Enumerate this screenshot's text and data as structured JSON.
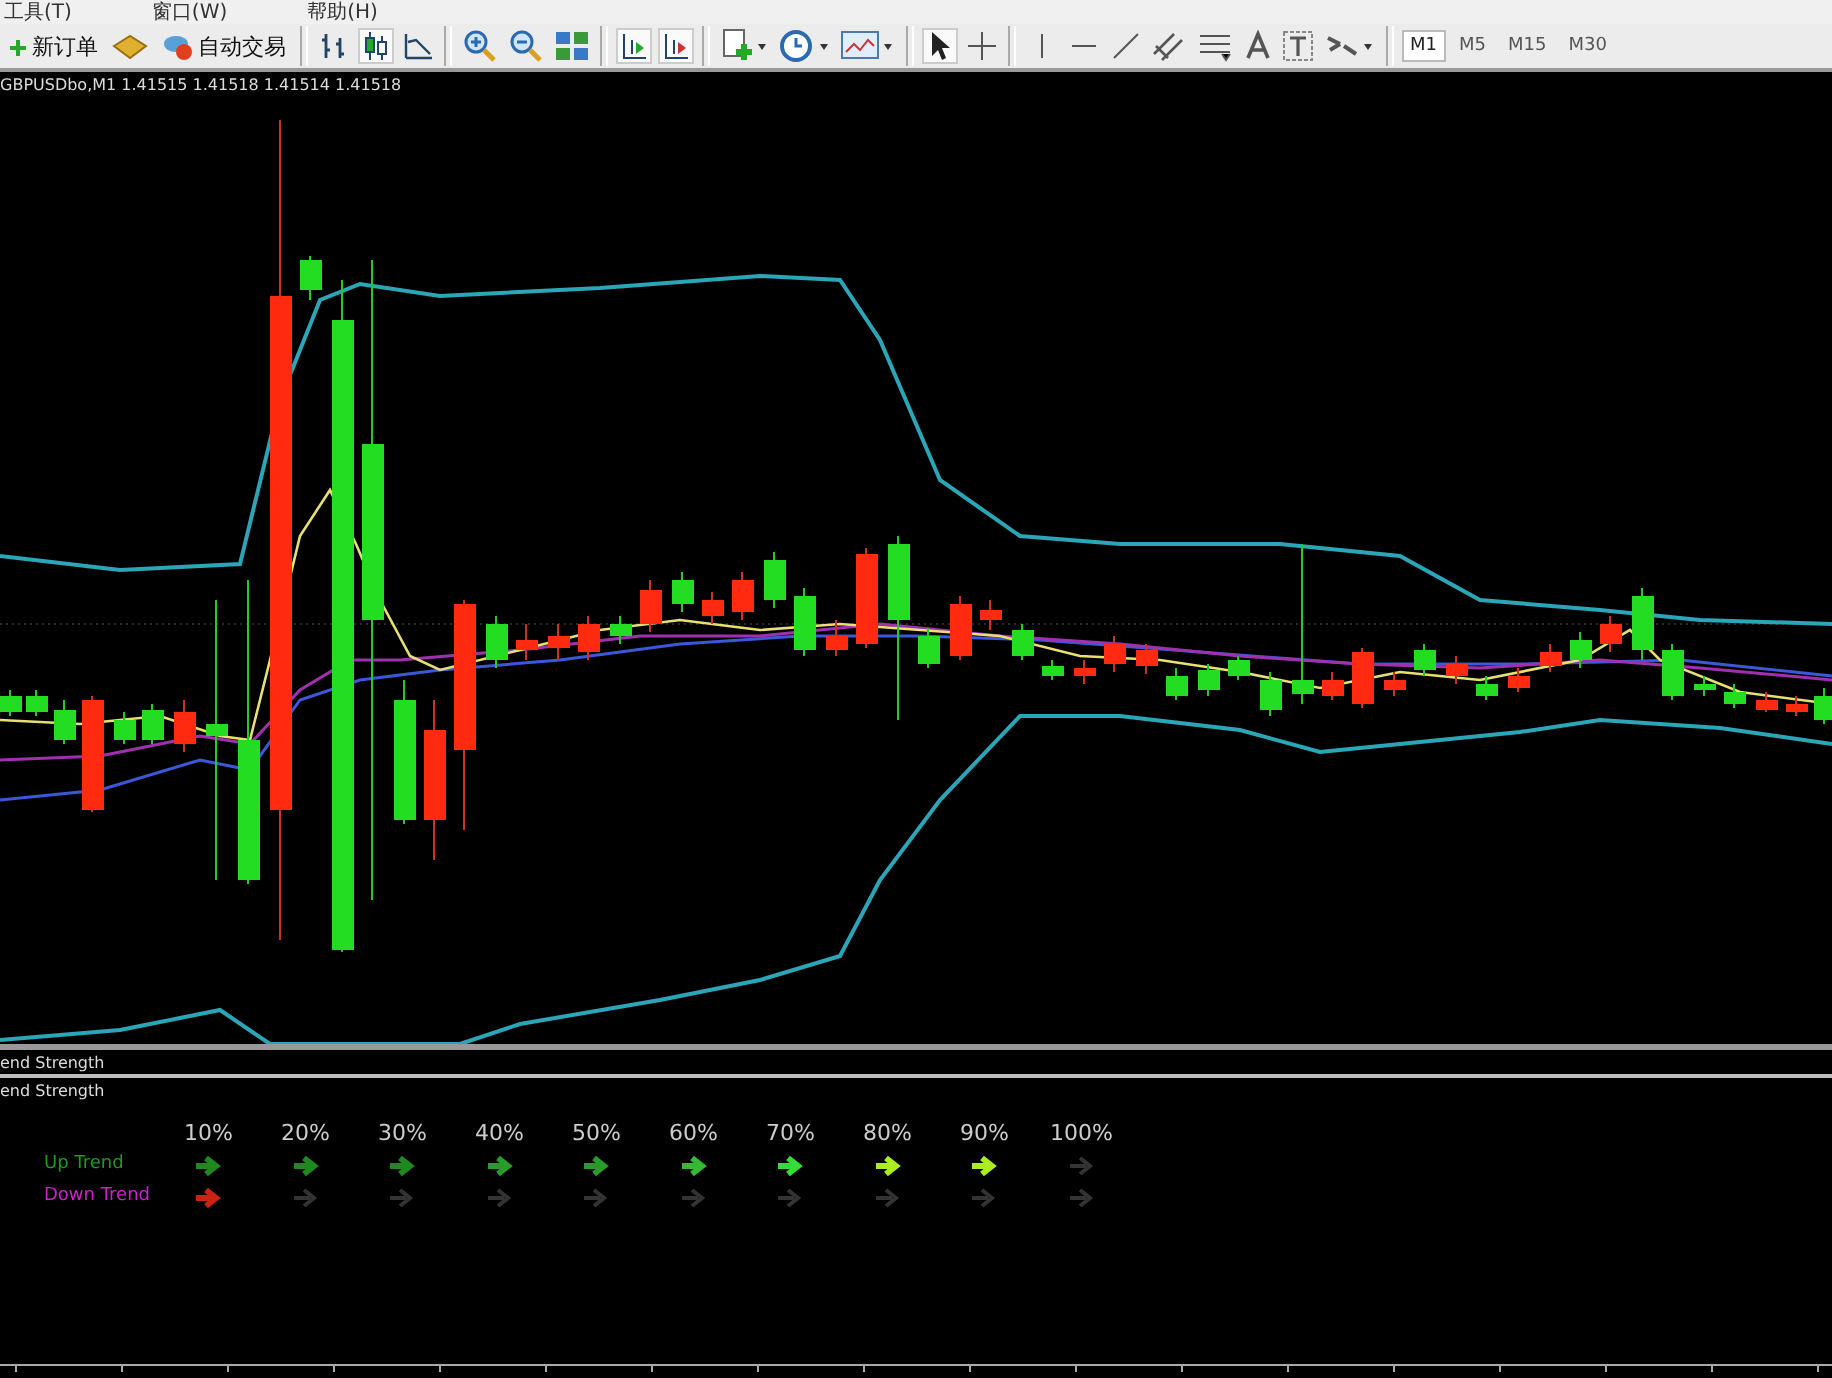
{
  "menu": [
    "工具(T)",
    "窗口(W)",
    "帮助(H)"
  ],
  "toolbar": {
    "buttons": [
      {
        "label": "新订单",
        "kind": "new-order"
      },
      {
        "label": "自动交易",
        "kind": "auto-trade"
      }
    ],
    "timeframes": [
      {
        "label": "M1",
        "selected": true
      },
      {
        "label": "M5",
        "selected": false
      },
      {
        "label": "M15",
        "selected": false
      },
      {
        "label": "M30",
        "selected": false
      }
    ]
  },
  "chart": {
    "label": "GBPUSDbo,M1  1.41515 1.41518 1.41514 1.41518"
  },
  "indicator_panels": [
    {
      "title": "end Strength"
    },
    {
      "title": "end Strength"
    }
  ],
  "trend_strength": {
    "levels": [
      "10%",
      "20%",
      "30%",
      "40%",
      "50%",
      "60%",
      "70%",
      "80%",
      "90%",
      "100%"
    ],
    "rows": [
      {
        "label": "Up Trend",
        "color": "#1e9a1e",
        "arrows": [
          {
            "on": true,
            "color": "#1e8a1e"
          },
          {
            "on": true,
            "color": "#1e8a1e"
          },
          {
            "on": true,
            "color": "#1e8a1e"
          },
          {
            "on": true,
            "color": "#2a9a2a"
          },
          {
            "on": true,
            "color": "#2a9a2a"
          },
          {
            "on": true,
            "color": "#33bb33"
          },
          {
            "on": true,
            "color": "#33dd33"
          },
          {
            "on": true,
            "color": "#aaee22"
          },
          {
            "on": true,
            "color": "#aaee22"
          },
          {
            "on": false,
            "color": "#333333"
          }
        ]
      },
      {
        "label": "Down Trend",
        "color": "#cc22cc",
        "arrows": [
          {
            "on": true,
            "color": "#cc2211"
          },
          {
            "on": false,
            "color": "#333333"
          },
          {
            "on": false,
            "color": "#333333"
          },
          {
            "on": false,
            "color": "#333333"
          },
          {
            "on": false,
            "color": "#333333"
          },
          {
            "on": false,
            "color": "#333333"
          },
          {
            "on": false,
            "color": "#333333"
          },
          {
            "on": false,
            "color": "#333333"
          },
          {
            "on": false,
            "color": "#333333"
          },
          {
            "on": false,
            "color": "#333333"
          }
        ]
      }
    ]
  }
}
